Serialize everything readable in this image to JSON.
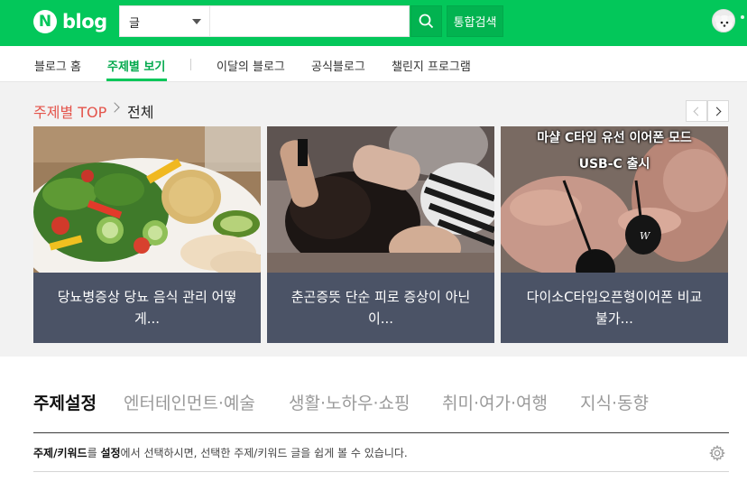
{
  "header": {
    "logo_letter": "N",
    "logo_text": "blog",
    "search_category": "글",
    "search_value": "",
    "search_button_icon": "search-icon",
    "total_search_label": "통합검색",
    "brand_color": "#03c75a"
  },
  "nav": {
    "items": [
      {
        "label": "블로그 홈"
      },
      {
        "label": "주제별 보기"
      },
      {
        "label": "이달의 블로그"
      },
      {
        "label": "공식블로그"
      },
      {
        "label": "챌린지 프로그램"
      }
    ],
    "active": "주제별 보기"
  },
  "topic": {
    "breadcrumb_title": "주제별 TOP",
    "breadcrumb_current": "전체",
    "cards": [
      {
        "caption": "당뇨병증상 당뇨 음식 관리 어떻게...",
        "image": "salad-plate-photo"
      },
      {
        "caption": "춘곤증뜻 단순 피로 증상이 아닌 이...",
        "image": "head-massage-photo"
      },
      {
        "caption": "다이소C타입오픈형이어폰 비교불가...",
        "image": "earphone-photo",
        "overlay_line1": "마샬 C타입 유선 이어폰 모드",
        "overlay_line2": "USB-C 출시"
      }
    ]
  },
  "settings": {
    "tabs": [
      {
        "label": "주제설정"
      },
      {
        "label": "엔터테인먼트·예술"
      },
      {
        "label": "생활·노하우·쇼핑"
      },
      {
        "label": "취미·여가·여행"
      },
      {
        "label": "지식·동향"
      }
    ],
    "info_bold1": "주제/키워드",
    "info_text1": "를 ",
    "info_bold2": "설정",
    "info_text2": "에서 선택하시면, 선택한 주제/키워드 글을 쉽게 볼 수 있습니다.",
    "gear_icon": "gear-icon"
  }
}
